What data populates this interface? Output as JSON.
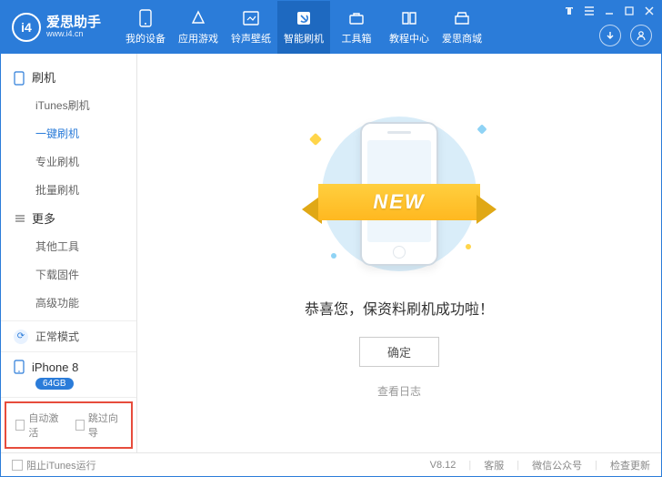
{
  "brand": {
    "name": "爱思助手",
    "url": "www.i4.cn",
    "badge": "i4"
  },
  "nav": [
    {
      "label": "我的设备"
    },
    {
      "label": "应用游戏"
    },
    {
      "label": "铃声壁纸"
    },
    {
      "label": "智能刷机"
    },
    {
      "label": "工具箱"
    },
    {
      "label": "教程中心"
    },
    {
      "label": "爱思商城"
    }
  ],
  "nav_active": 3,
  "sidebar": {
    "cat1": "刷机",
    "items1": [
      "iTunes刷机",
      "一键刷机",
      "专业刷机",
      "批量刷机"
    ],
    "items1_active": 1,
    "cat2": "更多",
    "items2": [
      "其他工具",
      "下载固件",
      "高级功能"
    ]
  },
  "mode": "正常模式",
  "device": {
    "name": "iPhone 8",
    "storage": "64GB"
  },
  "checks": {
    "auto": "自动激活",
    "skip": "跳过向导"
  },
  "main": {
    "ribbon": "NEW",
    "message": "恭喜您，保资料刷机成功啦！",
    "ok": "确定",
    "log": "查看日志"
  },
  "footer": {
    "block": "阻止iTunes运行",
    "version": "V8.12",
    "links": [
      "客服",
      "微信公众号",
      "检查更新"
    ]
  }
}
